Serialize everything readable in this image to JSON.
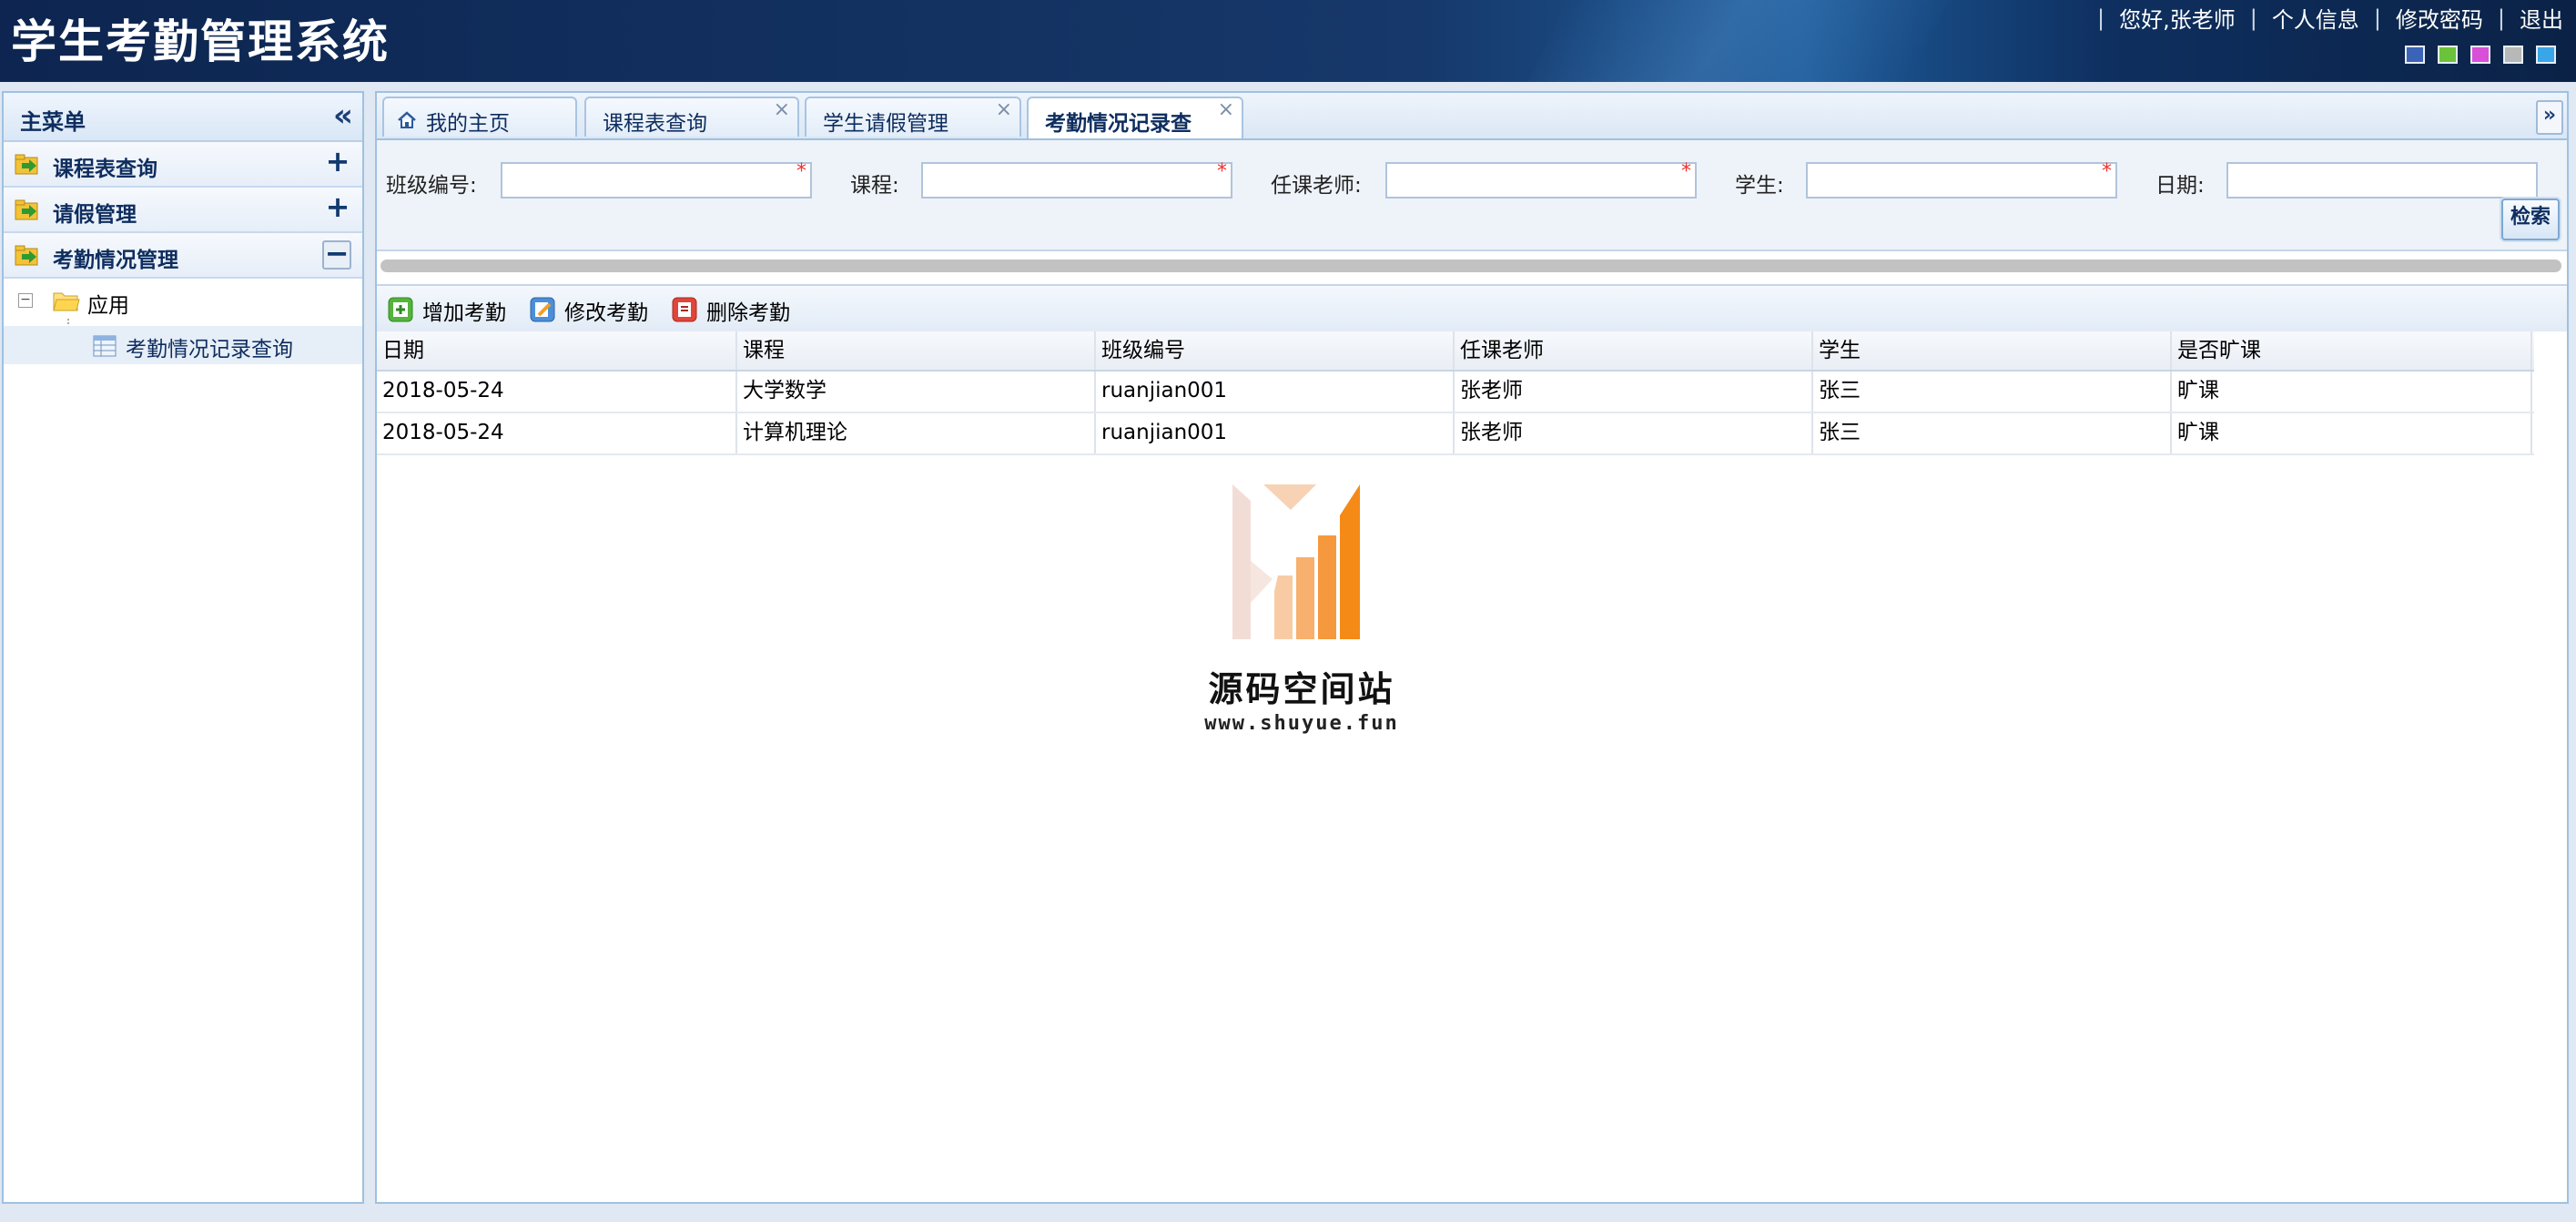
{
  "header": {
    "app_title": "学生考勤管理系统",
    "greeting": "您好,张老师",
    "links": [
      "个人信息",
      "修改密码",
      "退出"
    ],
    "theme_colors": [
      "#3b63b7",
      "#6bc33a",
      "#d94fd8",
      "#b8b8b8",
      "#39a6e8"
    ]
  },
  "sidebar": {
    "title": "主菜单",
    "collapse_icon": "double-chevron-left-icon",
    "sections": [
      {
        "label": "课程表查询",
        "toggle": "+"
      },
      {
        "label": "请假管理",
        "toggle": "+"
      },
      {
        "label": "考勤情况管理",
        "toggle": "−"
      }
    ],
    "tree": {
      "folder_label": "应用",
      "leaf_label": "考勤情况记录查询"
    }
  },
  "tabs": [
    {
      "label": "我的主页",
      "closable": false
    },
    {
      "label": "课程表查询",
      "closable": true
    },
    {
      "label": "学生请假管理",
      "closable": true
    },
    {
      "label": "考勤情况记录查",
      "closable": true,
      "active": true
    }
  ],
  "search": {
    "fields": [
      {
        "label": "班级编号:",
        "value": ""
      },
      {
        "label": "课程:",
        "value": ""
      },
      {
        "label": "任课老师:",
        "value": ""
      },
      {
        "label": "学生:",
        "value": ""
      },
      {
        "label": "日期:",
        "value": ""
      }
    ],
    "button_label": "检索"
  },
  "toolbar": {
    "add_label": "增加考勤",
    "edit_label": "修改考勤",
    "delete_label": "删除考勤"
  },
  "grid": {
    "columns": [
      "日期",
      "课程",
      "班级编号",
      "任课老师",
      "学生",
      "是否旷课"
    ],
    "rows": [
      [
        "2018-05-24",
        "大学数学",
        "ruanjian001",
        "张老师",
        "张三",
        "旷课"
      ],
      [
        "2018-05-24",
        "计算机理论",
        "ruanjian001",
        "张老师",
        "张三",
        "旷课"
      ]
    ]
  },
  "watermark": {
    "title": "源码空间站",
    "url": "www.shuyue.fun"
  }
}
